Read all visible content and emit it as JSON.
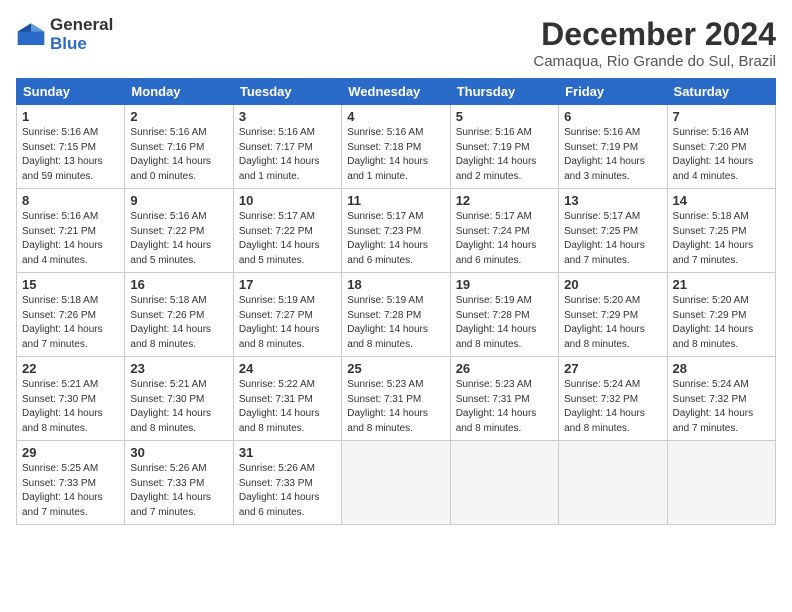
{
  "logo": {
    "general": "General",
    "blue": "Blue"
  },
  "title": "December 2024",
  "subtitle": "Camaqua, Rio Grande do Sul, Brazil",
  "days_of_week": [
    "Sunday",
    "Monday",
    "Tuesday",
    "Wednesday",
    "Thursday",
    "Friday",
    "Saturday"
  ],
  "weeks": [
    [
      {
        "day": 1,
        "info": "Sunrise: 5:16 AM\nSunset: 7:15 PM\nDaylight: 13 hours\nand 59 minutes."
      },
      {
        "day": 2,
        "info": "Sunrise: 5:16 AM\nSunset: 7:16 PM\nDaylight: 14 hours\nand 0 minutes."
      },
      {
        "day": 3,
        "info": "Sunrise: 5:16 AM\nSunset: 7:17 PM\nDaylight: 14 hours\nand 1 minute."
      },
      {
        "day": 4,
        "info": "Sunrise: 5:16 AM\nSunset: 7:18 PM\nDaylight: 14 hours\nand 1 minute."
      },
      {
        "day": 5,
        "info": "Sunrise: 5:16 AM\nSunset: 7:19 PM\nDaylight: 14 hours\nand 2 minutes."
      },
      {
        "day": 6,
        "info": "Sunrise: 5:16 AM\nSunset: 7:19 PM\nDaylight: 14 hours\nand 3 minutes."
      },
      {
        "day": 7,
        "info": "Sunrise: 5:16 AM\nSunset: 7:20 PM\nDaylight: 14 hours\nand 4 minutes."
      }
    ],
    [
      {
        "day": 8,
        "info": "Sunrise: 5:16 AM\nSunset: 7:21 PM\nDaylight: 14 hours\nand 4 minutes."
      },
      {
        "day": 9,
        "info": "Sunrise: 5:16 AM\nSunset: 7:22 PM\nDaylight: 14 hours\nand 5 minutes."
      },
      {
        "day": 10,
        "info": "Sunrise: 5:17 AM\nSunset: 7:22 PM\nDaylight: 14 hours\nand 5 minutes."
      },
      {
        "day": 11,
        "info": "Sunrise: 5:17 AM\nSunset: 7:23 PM\nDaylight: 14 hours\nand 6 minutes."
      },
      {
        "day": 12,
        "info": "Sunrise: 5:17 AM\nSunset: 7:24 PM\nDaylight: 14 hours\nand 6 minutes."
      },
      {
        "day": 13,
        "info": "Sunrise: 5:17 AM\nSunset: 7:25 PM\nDaylight: 14 hours\nand 7 minutes."
      },
      {
        "day": 14,
        "info": "Sunrise: 5:18 AM\nSunset: 7:25 PM\nDaylight: 14 hours\nand 7 minutes."
      }
    ],
    [
      {
        "day": 15,
        "info": "Sunrise: 5:18 AM\nSunset: 7:26 PM\nDaylight: 14 hours\nand 7 minutes."
      },
      {
        "day": 16,
        "info": "Sunrise: 5:18 AM\nSunset: 7:26 PM\nDaylight: 14 hours\nand 8 minutes."
      },
      {
        "day": 17,
        "info": "Sunrise: 5:19 AM\nSunset: 7:27 PM\nDaylight: 14 hours\nand 8 minutes."
      },
      {
        "day": 18,
        "info": "Sunrise: 5:19 AM\nSunset: 7:28 PM\nDaylight: 14 hours\nand 8 minutes."
      },
      {
        "day": 19,
        "info": "Sunrise: 5:19 AM\nSunset: 7:28 PM\nDaylight: 14 hours\nand 8 minutes."
      },
      {
        "day": 20,
        "info": "Sunrise: 5:20 AM\nSunset: 7:29 PM\nDaylight: 14 hours\nand 8 minutes."
      },
      {
        "day": 21,
        "info": "Sunrise: 5:20 AM\nSunset: 7:29 PM\nDaylight: 14 hours\nand 8 minutes."
      }
    ],
    [
      {
        "day": 22,
        "info": "Sunrise: 5:21 AM\nSunset: 7:30 PM\nDaylight: 14 hours\nand 8 minutes."
      },
      {
        "day": 23,
        "info": "Sunrise: 5:21 AM\nSunset: 7:30 PM\nDaylight: 14 hours\nand 8 minutes."
      },
      {
        "day": 24,
        "info": "Sunrise: 5:22 AM\nSunset: 7:31 PM\nDaylight: 14 hours\nand 8 minutes."
      },
      {
        "day": 25,
        "info": "Sunrise: 5:23 AM\nSunset: 7:31 PM\nDaylight: 14 hours\nand 8 minutes."
      },
      {
        "day": 26,
        "info": "Sunrise: 5:23 AM\nSunset: 7:31 PM\nDaylight: 14 hours\nand 8 minutes."
      },
      {
        "day": 27,
        "info": "Sunrise: 5:24 AM\nSunset: 7:32 PM\nDaylight: 14 hours\nand 8 minutes."
      },
      {
        "day": 28,
        "info": "Sunrise: 5:24 AM\nSunset: 7:32 PM\nDaylight: 14 hours\nand 7 minutes."
      }
    ],
    [
      {
        "day": 29,
        "info": "Sunrise: 5:25 AM\nSunset: 7:33 PM\nDaylight: 14 hours\nand 7 minutes."
      },
      {
        "day": 30,
        "info": "Sunrise: 5:26 AM\nSunset: 7:33 PM\nDaylight: 14 hours\nand 7 minutes."
      },
      {
        "day": 31,
        "info": "Sunrise: 5:26 AM\nSunset: 7:33 PM\nDaylight: 14 hours\nand 6 minutes."
      },
      null,
      null,
      null,
      null
    ]
  ]
}
